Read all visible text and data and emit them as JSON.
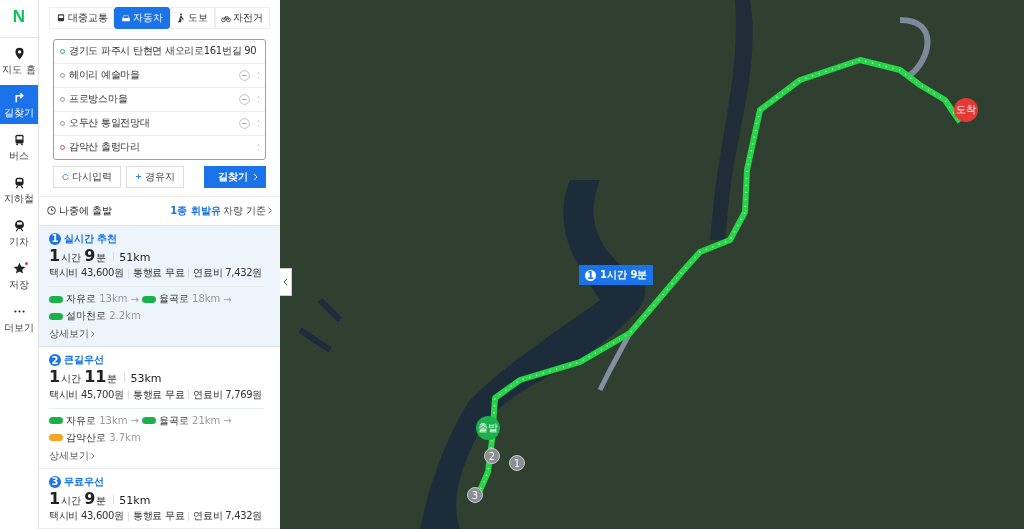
{
  "logo": "N",
  "rail": [
    {
      "label": "지도 홈",
      "selected": false,
      "dot": false
    },
    {
      "label": "길찾기",
      "selected": true,
      "dot": false
    },
    {
      "label": "버스",
      "selected": false,
      "dot": false
    },
    {
      "label": "지하철",
      "selected": false,
      "dot": false
    },
    {
      "label": "기차",
      "selected": false,
      "dot": false
    },
    {
      "label": "저장",
      "selected": false,
      "dot": true
    },
    {
      "label": "더보기",
      "selected": false,
      "dot": false
    }
  ],
  "mode_tabs": [
    {
      "label": "대중교통",
      "selected": false
    },
    {
      "label": "자동차",
      "selected": true
    },
    {
      "label": "도보",
      "selected": false
    },
    {
      "label": "자전거",
      "selected": false
    }
  ],
  "route_inputs": [
    {
      "kind": "start",
      "value": "경기도 파주시 탄현면 새오리로161번길 90",
      "removable": false
    },
    {
      "kind": "waypoint",
      "value": "헤이리 예술마을",
      "removable": true
    },
    {
      "kind": "waypoint",
      "value": "프로방스마을",
      "removable": true
    },
    {
      "kind": "waypoint",
      "value": "오두산 통일전망대",
      "removable": true
    },
    {
      "kind": "end",
      "value": "감악산 출렁다리",
      "removable": false
    }
  ],
  "buttons": {
    "reset": "다시입력",
    "add_waypoint": "경유지",
    "search": "길찾기"
  },
  "options": {
    "depart_later": "나중에 출발",
    "fuel": "1종 휘발유",
    "vehicle": "차량 기준"
  },
  "routes": [
    {
      "number": "1",
      "title": "실시간 추천",
      "selected": true,
      "hours": "1",
      "hour_unit": "시간",
      "minutes": "9",
      "minute_unit": "분",
      "distance": "51km",
      "taxi": "택시비 43,600원",
      "toll": "통행료 무료",
      "fuel": "연료비 7,432원",
      "roads": [
        {
          "name": "자유로",
          "length": "13km",
          "color": "#1bb04a",
          "next": "→"
        },
        {
          "name": "율곡로",
          "length": "18km",
          "color": "#1bb04a",
          "next": "→"
        },
        {
          "name": "설마천로",
          "length": "2.2km",
          "color": "#1bb04a"
        }
      ],
      "details": "상세보기"
    },
    {
      "number": "2",
      "title": "큰길우선",
      "selected": false,
      "hours": "1",
      "hour_unit": "시간",
      "minutes": "11",
      "minute_unit": "분",
      "distance": "53km",
      "taxi": "택시비 45,700원",
      "toll": "통행료 무료",
      "fuel": "연료비 7,769원",
      "roads": [
        {
          "name": "자유로",
          "length": "13km",
          "color": "#1bb04a",
          "next": "→"
        },
        {
          "name": "율곡로",
          "length": "21km",
          "color": "#1bb04a",
          "next": "→"
        },
        {
          "name": "감악산로",
          "length": "3.7km",
          "color": "#f5a623"
        }
      ],
      "details": "상세보기"
    },
    {
      "number": "3",
      "title": "무료우선",
      "selected": false,
      "hours": "1",
      "hour_unit": "시간",
      "minutes": "9",
      "minute_unit": "분",
      "distance": "51km",
      "taxi": "택시비 43,600원",
      "toll": "통행료 무료",
      "fuel": "연료비 7,432원"
    }
  ],
  "map": {
    "route_label": {
      "number": "1",
      "text": "1시간 9분"
    },
    "start_label": "출발",
    "end_label": "도착",
    "waypoints": [
      "1",
      "2",
      "3"
    ]
  }
}
